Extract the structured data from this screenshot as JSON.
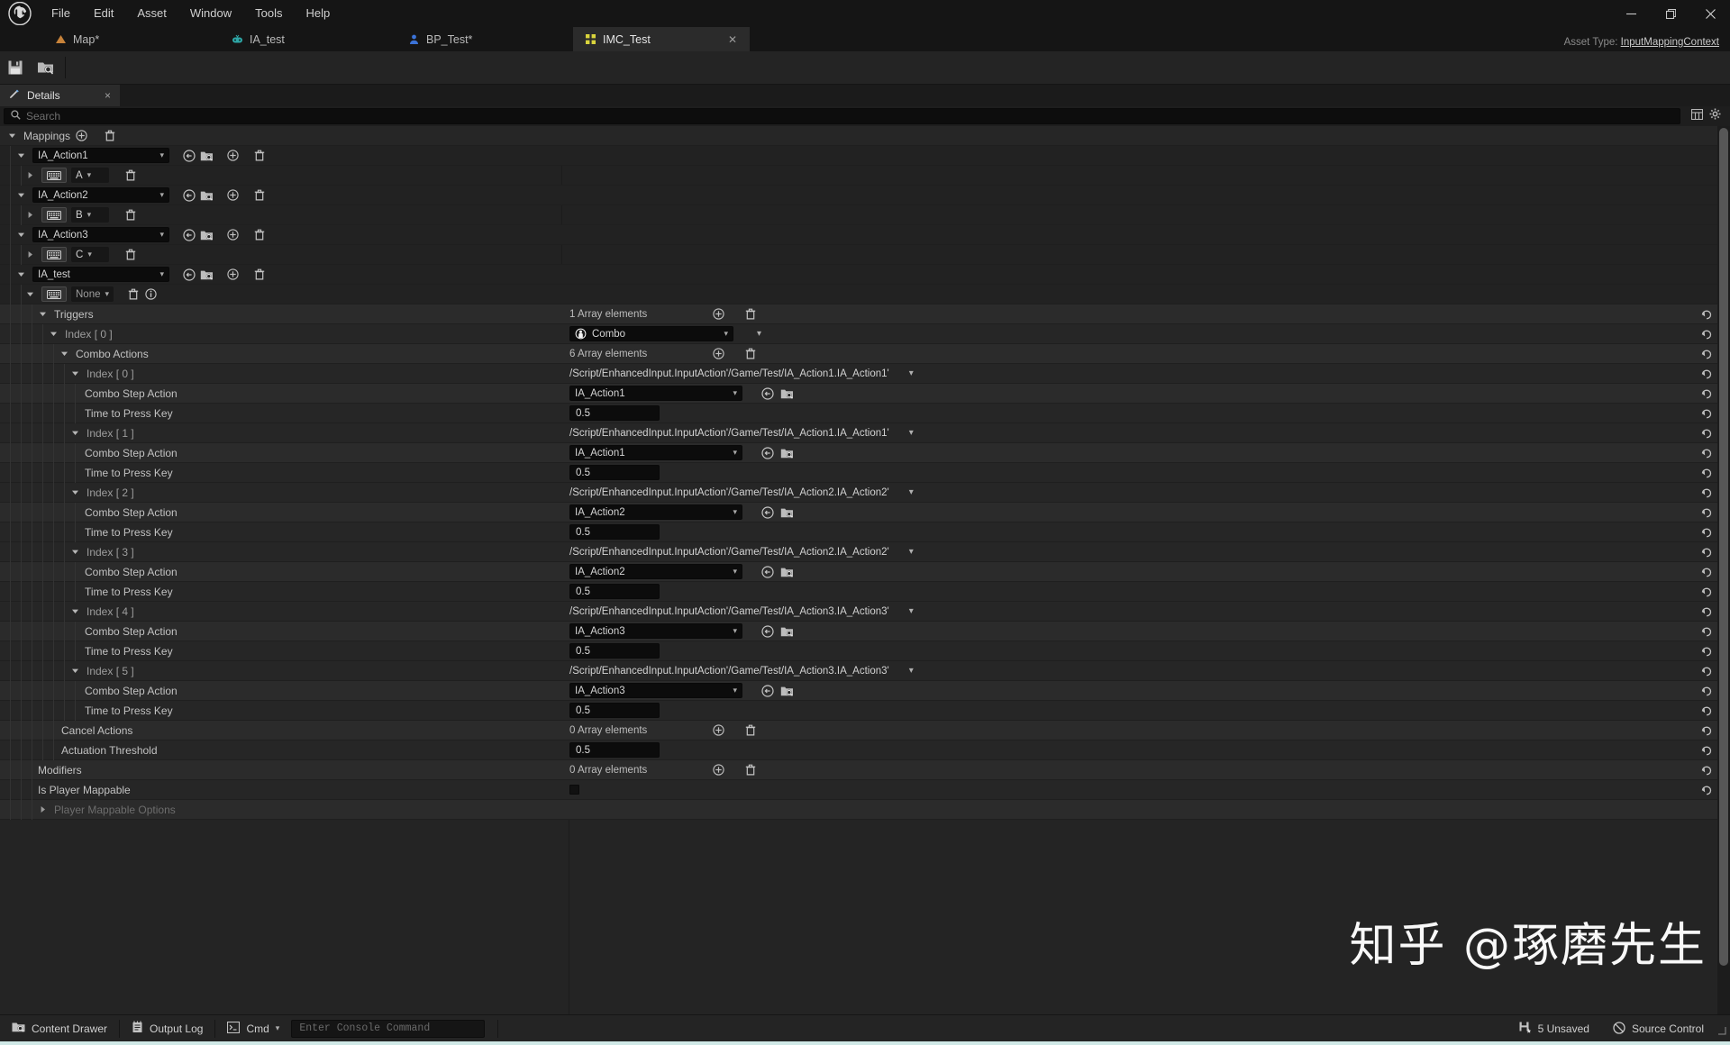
{
  "titlebar": {
    "logo_icon": "unreal-engine-logo",
    "menu": [
      "File",
      "Edit",
      "Asset",
      "Window",
      "Tools",
      "Help"
    ],
    "minimize_icon": "minimize-icon",
    "maximize_icon": "restore-icon",
    "close_icon": "close-icon"
  },
  "tabs": [
    {
      "label": "Map*",
      "icon": "map-icon",
      "active": false
    },
    {
      "label": "IA_test",
      "icon": "input-action-icon",
      "active": false
    },
    {
      "label": "BP_Test*",
      "icon": "blueprint-icon",
      "active": false
    },
    {
      "label": "IMC_Test",
      "icon": "input-mapping-context-icon",
      "active": true
    }
  ],
  "asset_type": {
    "prefix": "Asset Type: ",
    "value": "InputMappingContext"
  },
  "toolbar": {
    "save_label": "Save",
    "browse_label": "Browse"
  },
  "panel": {
    "title": "Details",
    "icon": "details-icon",
    "close": "×"
  },
  "search": {
    "placeholder": "Search",
    "value": "",
    "icon": "search-icon",
    "column_icon": "columns-icon",
    "settings_icon": "gear-icon"
  },
  "labels": {
    "mappings": "Mappings",
    "triggers": "Triggers",
    "combo_actions": "Combo Actions",
    "combo_step_action": "Combo Step Action",
    "time_to_press_key": "Time to Press Key",
    "cancel_actions": "Cancel Actions",
    "actuation_threshold": "Actuation Threshold",
    "modifiers": "Modifiers",
    "is_player_mappable": "Is Player Mappable",
    "player_mappable_options": "Player Mappable Options"
  },
  "mappings": [
    {
      "action": "IA_Action1",
      "key": "A"
    },
    {
      "action": "IA_Action2",
      "key": "B"
    },
    {
      "action": "IA_Action3",
      "key": "C"
    },
    {
      "action": "IA_test",
      "key": "None"
    }
  ],
  "triggers": {
    "count_label": "1 Array elements",
    "index_label": "Index [ 0 ]",
    "trigger_type": "Combo",
    "trigger_icon": "combo-trigger-icon"
  },
  "combo_actions": {
    "count_label": "6 Array elements",
    "items": [
      {
        "index_label": "Index [ 0 ]",
        "path": "/Script/EnhancedInput.InputAction'/Game/Test/IA_Action1.IA_Action1'",
        "step_action": "IA_Action1",
        "time": "0.5"
      },
      {
        "index_label": "Index [ 1 ]",
        "path": "/Script/EnhancedInput.InputAction'/Game/Test/IA_Action1.IA_Action1'",
        "step_action": "IA_Action1",
        "time": "0.5"
      },
      {
        "index_label": "Index [ 2 ]",
        "path": "/Script/EnhancedInput.InputAction'/Game/Test/IA_Action2.IA_Action2'",
        "step_action": "IA_Action2",
        "time": "0.5"
      },
      {
        "index_label": "Index [ 3 ]",
        "path": "/Script/EnhancedInput.InputAction'/Game/Test/IA_Action2.IA_Action2'",
        "step_action": "IA_Action2",
        "time": "0.5"
      },
      {
        "index_label": "Index [ 4 ]",
        "path": "/Script/EnhancedInput.InputAction'/Game/Test/IA_Action3.IA_Action3'",
        "step_action": "IA_Action3",
        "time": "0.5"
      },
      {
        "index_label": "Index [ 5 ]",
        "path": "/Script/EnhancedInput.InputAction'/Game/Test/IA_Action3.IA_Action3'",
        "step_action": "IA_Action3",
        "time": "0.5"
      }
    ]
  },
  "footer_props": {
    "cancel_actions_count": "0 Array elements",
    "actuation_threshold_value": "0.5",
    "modifiers_count": "0 Array elements",
    "is_player_mappable_checked": false
  },
  "watermark": "知乎 @琢磨先生",
  "statusbar": {
    "content_drawer": "Content Drawer",
    "output_log": "Output Log",
    "cmd": "Cmd",
    "console_placeholder": "Enter Console Command",
    "unsaved": "5 Unsaved",
    "source_control": "Source Control"
  }
}
